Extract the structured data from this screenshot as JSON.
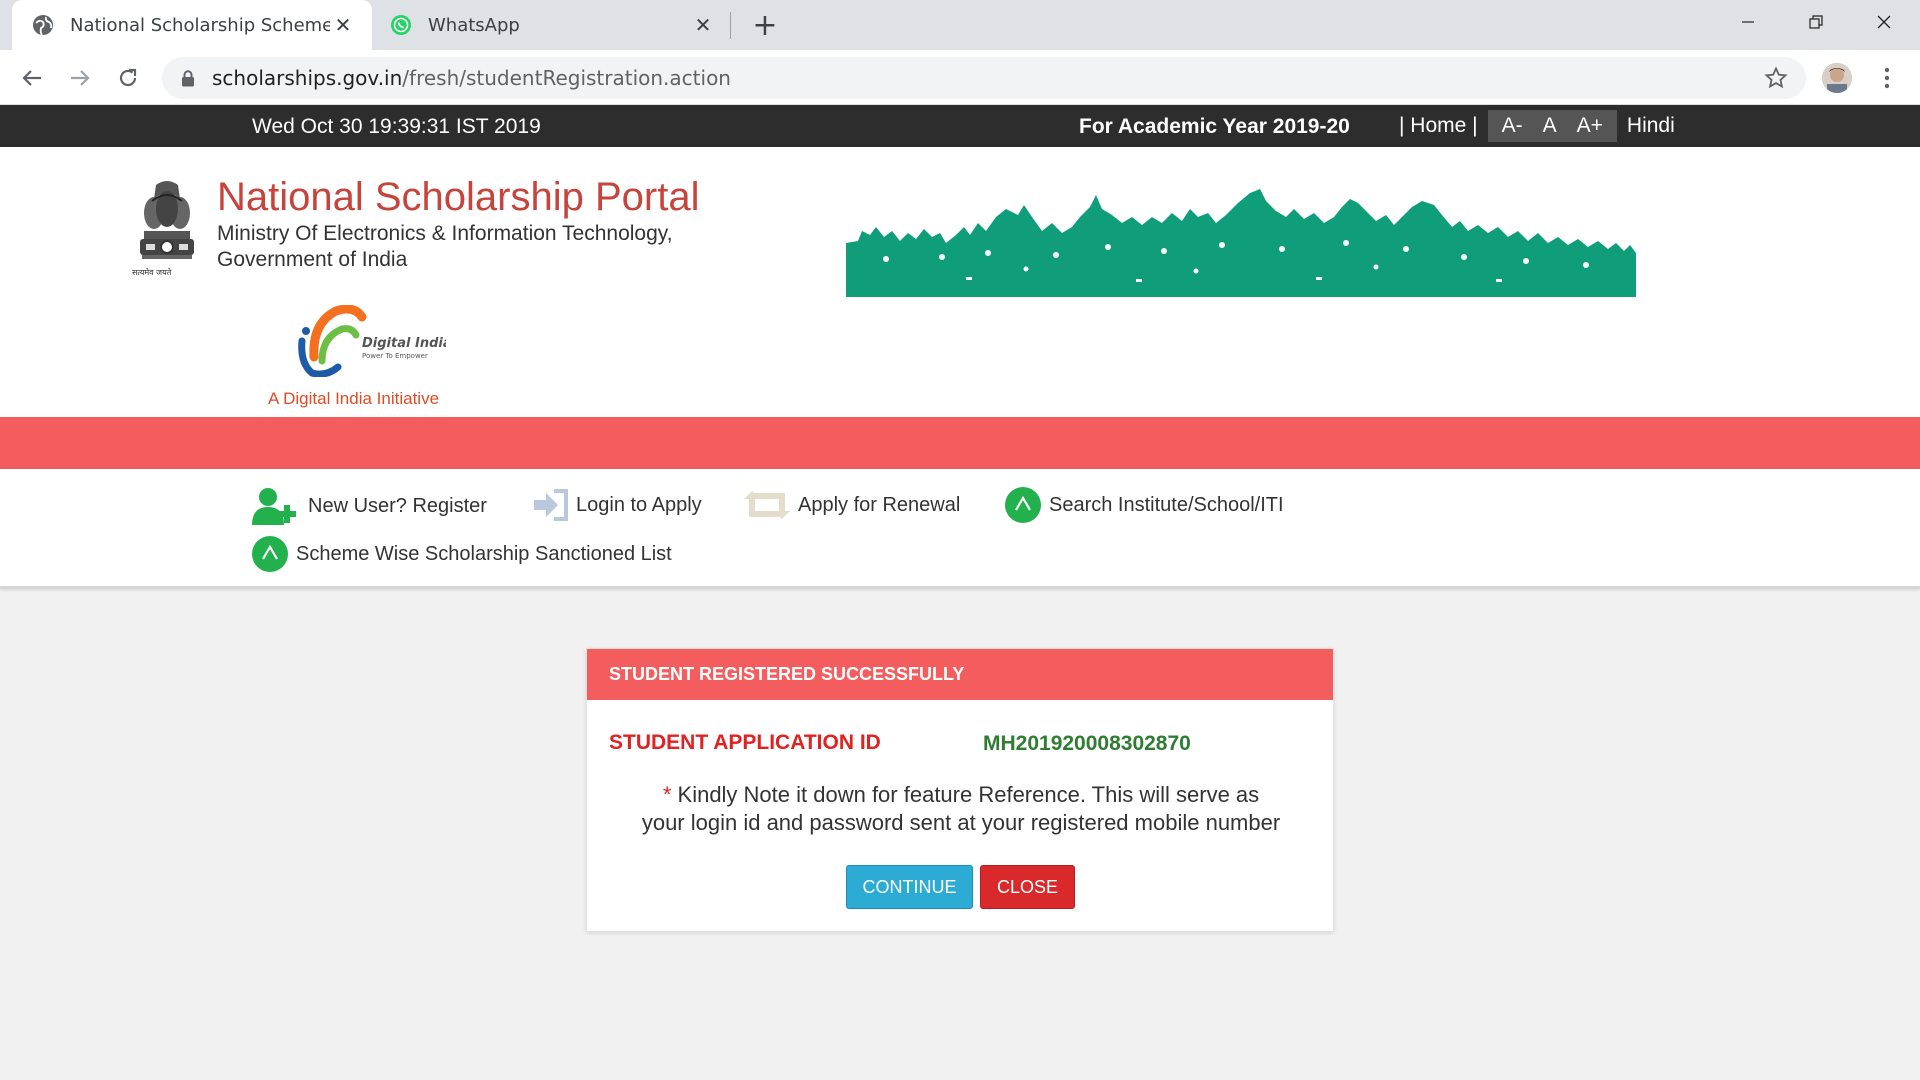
{
  "browser": {
    "tabs": [
      {
        "title": "National Scholarship Scheme",
        "active": true,
        "icon": "globe-icon"
      },
      {
        "title": "WhatsApp",
        "active": false,
        "icon": "whatsapp-icon"
      }
    ],
    "url_domain": "scholarships.gov.in",
    "url_path": "/fresh/studentRegistration.action"
  },
  "topbar": {
    "datetime": "Wed Oct 30 19:39:31 IST 2019",
    "academic_year": "For Academic Year 2019-20",
    "home_link": "| Home |",
    "font_small": "A-",
    "font_normal": "A",
    "font_large": "A+",
    "language": "Hindi"
  },
  "header": {
    "portal_title": "National Scholarship Portal",
    "ministry_line1": "Ministry Of Electronics & Information Technology,",
    "ministry_line2": "Government of India",
    "emblem_motto": "सत्यमेव जयते",
    "digital_india_title": "Digital India",
    "digital_india_tagline": "Power To Empower",
    "digital_india_caption": "A Digital India Initiative"
  },
  "nav": {
    "register": "New User? Register",
    "login": "Login to Apply",
    "renewal": "Apply for Renewal",
    "search": "Search Institute/School/ITI",
    "sanctioned": "Scheme Wise Scholarship Sanctioned List"
  },
  "modal": {
    "heading": "STUDENT REGISTERED SUCCESSFULLY",
    "app_id_label": "STUDENT APPLICATION ID",
    "app_id_value": "MH201920008302870",
    "note_asterisk": "*",
    "note_line1": "Kindly Note it down for feature Reference. This will serve as",
    "note_line2": "your login id and password sent at your registered mobile number",
    "continue_label": "CONTINUE",
    "close_label": "CLOSE"
  },
  "colors": {
    "accent_red": "#f45d5d",
    "topbar_bg": "#2d2d2d",
    "banner_green": "#0f9d7a",
    "continue_blue": "#2cacd4",
    "close_red": "#d9292a",
    "app_id_green": "#2e7d32"
  }
}
